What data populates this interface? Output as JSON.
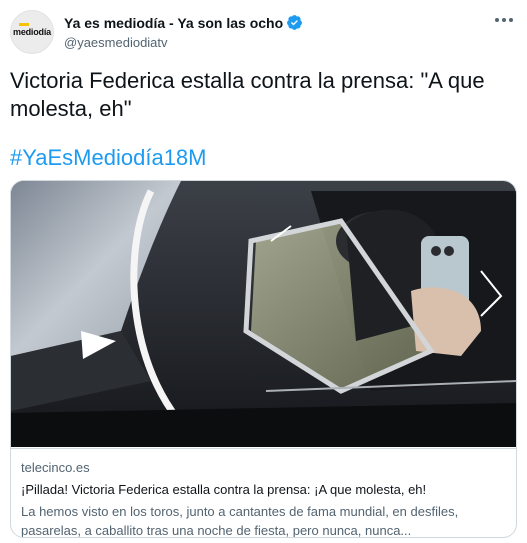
{
  "author": {
    "display_name": "Ya es mediodía - Ya son las ocho",
    "handle": "@yaesmediodiatv",
    "avatar_text": "mediodía",
    "verified": true
  },
  "tweet": {
    "text": "Victoria Federica estalla contra la prensa: \"A que molesta, eh\"",
    "hashtag": "#YaEsMediodía18M"
  },
  "link_card": {
    "domain": "telecinco.es",
    "title": "¡Pillada! Victoria Federica estalla contra la prensa: ¡A que molesta, eh!",
    "description": "La hemos visto en los toros, junto a cantantes de fama mundial, en desfiles, pasarelas, a caballito tras una noche de fiesta, pero nunca, nunca..."
  },
  "colors": {
    "link_blue": "#1d9bf0",
    "secondary_text": "#536471",
    "border": "#cfd9de"
  }
}
